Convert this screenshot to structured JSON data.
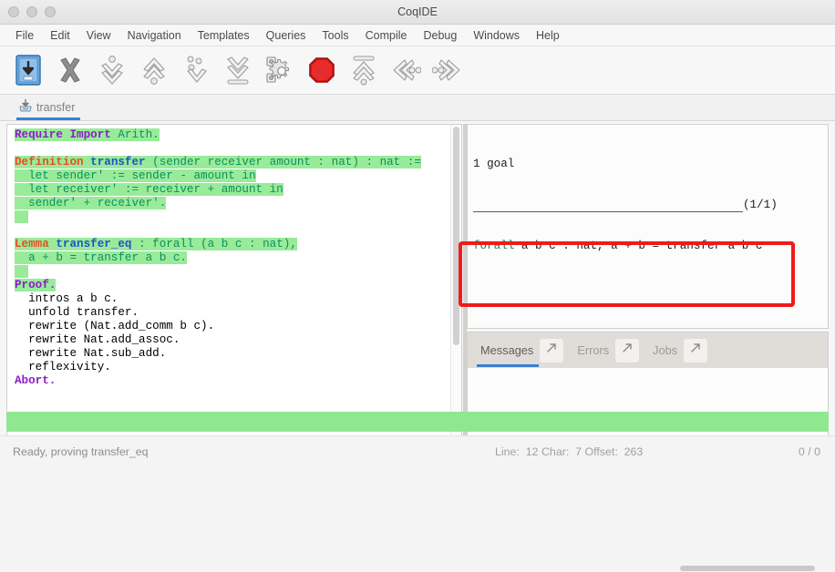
{
  "window": {
    "title": "CoqIDE",
    "controls": [
      "close",
      "minimize",
      "maximize"
    ]
  },
  "menubar": {
    "items": [
      {
        "label": "File"
      },
      {
        "label": "Edit"
      },
      {
        "label": "View"
      },
      {
        "label": "Navigation"
      },
      {
        "label": "Templates"
      },
      {
        "label": "Queries"
      },
      {
        "label": "Tools"
      },
      {
        "label": "Compile"
      },
      {
        "label": "Debug"
      },
      {
        "label": "Windows"
      },
      {
        "label": "Help"
      }
    ]
  },
  "toolbar": {
    "buttons": [
      {
        "name": "save-icon",
        "title": "Save"
      },
      {
        "name": "close-x-icon",
        "title": "Close"
      },
      {
        "name": "forward-one-icon",
        "title": "Forward one command"
      },
      {
        "name": "backward-one-icon",
        "title": "Backward one command"
      },
      {
        "name": "go-to-cursor-icon",
        "title": "Go to cursor"
      },
      {
        "name": "go-to-end-icon",
        "title": "Go to end"
      },
      {
        "name": "compile-gears-icon",
        "title": "Compile"
      },
      {
        "name": "stop-icon",
        "title": "Interrupt"
      },
      {
        "name": "restart-icon",
        "title": "Restart"
      },
      {
        "name": "previous-occurrence-icon",
        "title": "Previous"
      },
      {
        "name": "next-occurrence-icon",
        "title": "Next"
      }
    ]
  },
  "document_tab": {
    "label": "transfer",
    "icon": "save-document-icon",
    "active": true
  },
  "editor": {
    "lines": [
      {
        "segments": [
          {
            "text": "Require Import ",
            "style": "kw-purple",
            "hl": true
          },
          {
            "text": "Arith.",
            "style": "kw-teal",
            "hl": true
          }
        ]
      },
      {
        "segments": [
          {
            "text": "",
            "style": "",
            "hl": false
          }
        ]
      },
      {
        "segments": [
          {
            "text": "Definition ",
            "style": "kw-red",
            "hl": true
          },
          {
            "text": "transfer ",
            "style": "kw-blue",
            "hl": true
          },
          {
            "text": "(sender receiver amount : nat) : nat :=",
            "style": "kw-teal",
            "hl": true
          }
        ]
      },
      {
        "segments": [
          {
            "text": "  let sender' := sender - amount in",
            "style": "kw-teal",
            "hl": true
          }
        ]
      },
      {
        "segments": [
          {
            "text": "  let receiver' := receiver + amount in",
            "style": "kw-teal",
            "hl": true
          }
        ]
      },
      {
        "segments": [
          {
            "text": "  sender' + receiver'.",
            "style": "kw-teal",
            "hl": true
          }
        ]
      },
      {
        "segments": [
          {
            "text": "  ",
            "style": "",
            "hl": true
          }
        ]
      },
      {
        "segments": [
          {
            "text": "",
            "style": "",
            "hl": false
          }
        ]
      },
      {
        "segments": [
          {
            "text": "Lemma ",
            "style": "kw-red",
            "hl": true
          },
          {
            "text": "transfer_eq ",
            "style": "kw-blue",
            "hl": true
          },
          {
            "text": ": forall (a b c : nat),",
            "style": "kw-teal",
            "hl": true
          }
        ]
      },
      {
        "segments": [
          {
            "text": "  a + b = transfer a b c.",
            "style": "kw-teal",
            "hl": true
          }
        ]
      },
      {
        "segments": [
          {
            "text": "  ",
            "style": "",
            "hl": true
          }
        ]
      },
      {
        "segments": [
          {
            "text": "Proof.",
            "style": "kw-purple",
            "hl": true
          }
        ]
      },
      {
        "segments": [
          {
            "text": "  intros a b c.",
            "style": "",
            "hl": false
          }
        ]
      },
      {
        "segments": [
          {
            "text": "  unfold transfer.",
            "style": "",
            "hl": false
          }
        ]
      },
      {
        "segments": [
          {
            "text": "  rewrite (Nat.add_comm b c).",
            "style": "",
            "hl": false
          }
        ]
      },
      {
        "segments": [
          {
            "text": "  rewrite Nat.add_assoc.",
            "style": "",
            "hl": false
          }
        ]
      },
      {
        "segments": [
          {
            "text": "  rewrite Nat.sub_add.",
            "style": "",
            "hl": false
          }
        ]
      },
      {
        "segments": [
          {
            "text": "  reflexivity.",
            "style": "",
            "hl": false
          }
        ]
      },
      {
        "segments": [
          {
            "text": "Abort.",
            "style": "kw-purple",
            "hl": false
          }
        ]
      }
    ]
  },
  "goal_panel": {
    "header": "1 goal",
    "counter": "(1/1)",
    "goal_keyword": "forall",
    "goal_rest": " a b c : nat, a + b = transfer a b c"
  },
  "message_tabs": {
    "tabs": [
      {
        "label": "Messages",
        "active": true,
        "detach_icon": "detach-arrow-icon"
      },
      {
        "label": "Errors",
        "active": false,
        "detach_icon": "detach-arrow-icon"
      },
      {
        "label": "Jobs",
        "active": false,
        "detach_icon": "detach-arrow-icon"
      }
    ],
    "body_text": ""
  },
  "statusbar": {
    "left": "Ready, proving transfer_eq",
    "position": "Line:  12 Char:  7 Offset:  263",
    "right": "0 / 0"
  },
  "colors": {
    "accent_blue": "#3d7fd1",
    "processed_green": "#99eb99",
    "progress_green": "#8fe88f",
    "annotation_red": "#ee1b1b",
    "keyword_purple": "#8a1fc6",
    "keyword_red": "#ef4b21",
    "keyword_blue": "#2052c8",
    "keyword_teal": "#0a8f60"
  }
}
